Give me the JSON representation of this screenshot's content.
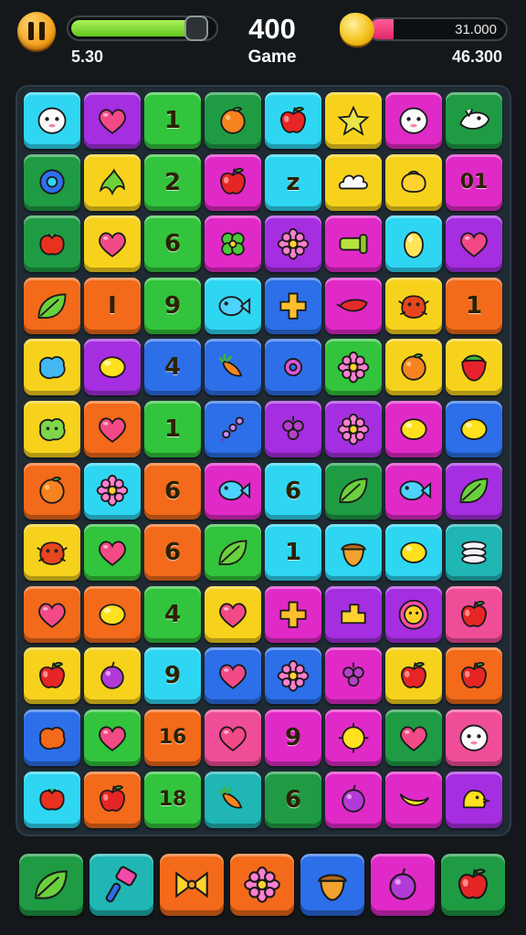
{
  "hud": {
    "energy_label": "5.30",
    "energy_level": 0.85,
    "score": "400",
    "mode": "Game",
    "coin_bar_text": "31.000",
    "coin_bar_level": 0.18,
    "coins": "46.300",
    "colors": {
      "energy": "#63c71e",
      "coin_bar": "#e3256b",
      "pause": "#f39a12"
    }
  },
  "palette": {
    "cyan": "#2fd6f2",
    "purple": "#a52ee0",
    "green": "#32c43c",
    "dkgreen": "#1f9b44",
    "yellow": "#f7d21c",
    "magenta": "#e02ac7",
    "orange": "#f26a1a",
    "blue": "#2c6fe8",
    "teal": "#1fb6b4",
    "red": "#ef3f3f",
    "pink": "#f04d98",
    "lime": "#b7e52a"
  },
  "board": {
    "rows": [
      [
        {
          "color": "cyan",
          "icon": "ghost-face"
        },
        {
          "color": "purple",
          "icon": "heart"
        },
        {
          "color": "green",
          "icon": "number",
          "label": "1"
        },
        {
          "color": "dkgreen",
          "icon": "orange-fruit"
        },
        {
          "color": "cyan",
          "icon": "apple"
        },
        {
          "color": "yellow",
          "icon": "star-fruit"
        },
        {
          "color": "magenta",
          "icon": "ghost-face"
        },
        {
          "color": "dkgreen",
          "icon": "bird-face"
        }
      ],
      [
        {
          "color": "dkgreen",
          "icon": "ring"
        },
        {
          "color": "yellow",
          "icon": "leaf-cluster"
        },
        {
          "color": "green",
          "icon": "number",
          "label": "2"
        },
        {
          "color": "magenta",
          "icon": "apple"
        },
        {
          "color": "cyan",
          "icon": "number",
          "label": "z"
        },
        {
          "color": "yellow",
          "icon": "cloud"
        },
        {
          "color": "yellow",
          "icon": "bag"
        },
        {
          "color": "magenta",
          "icon": "number",
          "label": "01"
        }
      ],
      [
        {
          "color": "dkgreen",
          "icon": "berry-red"
        },
        {
          "color": "yellow",
          "icon": "heart"
        },
        {
          "color": "green",
          "icon": "number",
          "label": "6"
        },
        {
          "color": "magenta",
          "icon": "clover"
        },
        {
          "color": "purple",
          "icon": "flower"
        },
        {
          "color": "magenta",
          "icon": "pipe"
        },
        {
          "color": "cyan",
          "icon": "egg"
        },
        {
          "color": "purple",
          "icon": "heart"
        }
      ],
      [
        {
          "color": "orange",
          "icon": "leaf"
        },
        {
          "color": "orange",
          "icon": "number",
          "label": "I"
        },
        {
          "color": "green",
          "icon": "number",
          "label": "9"
        },
        {
          "color": "cyan",
          "icon": "fish"
        },
        {
          "color": "blue",
          "icon": "plus-flower"
        },
        {
          "color": "magenta",
          "icon": "pepper"
        },
        {
          "color": "yellow",
          "icon": "crab"
        },
        {
          "color": "orange",
          "icon": "number",
          "label": "1"
        }
      ],
      [
        {
          "color": "yellow",
          "icon": "blob-blue"
        },
        {
          "color": "purple",
          "icon": "lemon"
        },
        {
          "color": "blue",
          "icon": "number",
          "label": "4"
        },
        {
          "color": "blue",
          "icon": "carrot"
        },
        {
          "color": "blue",
          "icon": "ring-small"
        },
        {
          "color": "green",
          "icon": "flower"
        },
        {
          "color": "yellow",
          "icon": "orange-fruit"
        },
        {
          "color": "yellow",
          "icon": "strawberry"
        }
      ],
      [
        {
          "color": "yellow",
          "icon": "blob-green"
        },
        {
          "color": "orange",
          "icon": "heart"
        },
        {
          "color": "green",
          "icon": "number",
          "label": "1"
        },
        {
          "color": "blue",
          "icon": "sprig"
        },
        {
          "color": "purple",
          "icon": "grape"
        },
        {
          "color": "purple",
          "icon": "flower"
        },
        {
          "color": "magenta",
          "icon": "lemon"
        },
        {
          "color": "blue",
          "icon": "lemon"
        }
      ],
      [
        {
          "color": "orange",
          "icon": "orange-fruit"
        },
        {
          "color": "cyan",
          "icon": "flower"
        },
        {
          "color": "orange",
          "icon": "number",
          "label": "6"
        },
        {
          "color": "magenta",
          "icon": "fish"
        },
        {
          "color": "cyan",
          "icon": "number",
          "label": "6"
        },
        {
          "color": "dkgreen",
          "icon": "leaf"
        },
        {
          "color": "magenta",
          "icon": "fish"
        },
        {
          "color": "purple",
          "icon": "leaf"
        }
      ],
      [
        {
          "color": "yellow",
          "icon": "crab"
        },
        {
          "color": "green",
          "icon": "heart"
        },
        {
          "color": "orange",
          "icon": "number",
          "label": "6"
        },
        {
          "color": "green",
          "icon": "leaf"
        },
        {
          "color": "cyan",
          "icon": "number",
          "label": "1"
        },
        {
          "color": "cyan",
          "icon": "acorn"
        },
        {
          "color": "cyan",
          "icon": "lemon"
        },
        {
          "color": "teal",
          "icon": "stack"
        }
      ],
      [
        {
          "color": "orange",
          "icon": "heart"
        },
        {
          "color": "orange",
          "icon": "lemon"
        },
        {
          "color": "green",
          "icon": "number",
          "label": "4"
        },
        {
          "color": "yellow",
          "icon": "heart"
        },
        {
          "color": "magenta",
          "icon": "plus-flower"
        },
        {
          "color": "purple",
          "icon": "block"
        },
        {
          "color": "purple",
          "icon": "sun-face"
        },
        {
          "color": "pink",
          "icon": "apple"
        }
      ],
      [
        {
          "color": "yellow",
          "icon": "apple"
        },
        {
          "color": "yellow",
          "icon": "plum"
        },
        {
          "color": "cyan",
          "icon": "number",
          "label": "9"
        },
        {
          "color": "blue",
          "icon": "heart"
        },
        {
          "color": "blue",
          "icon": "flower"
        },
        {
          "color": "magenta",
          "icon": "grape"
        },
        {
          "color": "yellow",
          "icon": "apple"
        },
        {
          "color": "orange",
          "icon": "apple"
        }
      ],
      [
        {
          "color": "blue",
          "icon": "blob-orange"
        },
        {
          "color": "green",
          "icon": "heart"
        },
        {
          "color": "orange",
          "icon": "number",
          "label": "16"
        },
        {
          "color": "pink",
          "icon": "heart"
        },
        {
          "color": "magenta",
          "icon": "number",
          "label": "9"
        },
        {
          "color": "magenta",
          "icon": "sun"
        },
        {
          "color": "dkgreen",
          "icon": "heart"
        },
        {
          "color": "pink",
          "icon": "ghost-face"
        }
      ],
      [
        {
          "color": "cyan",
          "icon": "berry-red"
        },
        {
          "color": "orange",
          "icon": "apple"
        },
        {
          "color": "green",
          "icon": "number",
          "label": "18"
        },
        {
          "color": "teal",
          "icon": "carrot"
        },
        {
          "color": "dkgreen",
          "icon": "number",
          "label": "6"
        },
        {
          "color": "magenta",
          "icon": "plum"
        },
        {
          "color": "magenta",
          "icon": "banana"
        },
        {
          "color": "purple",
          "icon": "chick"
        }
      ]
    ]
  },
  "boosters": [
    {
      "color": "dkgreen",
      "icon": "leaf"
    },
    {
      "color": "teal",
      "icon": "hammer"
    },
    {
      "color": "orange",
      "icon": "bow"
    },
    {
      "color": "orange",
      "icon": "flower"
    },
    {
      "color": "blue",
      "icon": "acorn"
    },
    {
      "color": "magenta",
      "icon": "plum"
    },
    {
      "color": "dkgreen",
      "icon": "apple"
    }
  ]
}
